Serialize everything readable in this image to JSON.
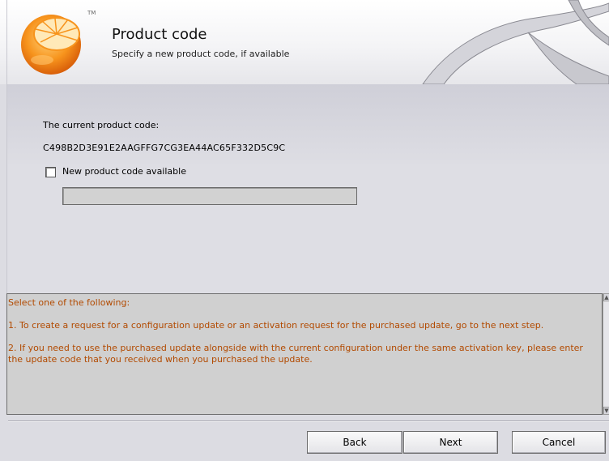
{
  "header": {
    "title": "Product code",
    "subtitle": "Specify a new product code, if available",
    "logo_icon": "orange-slice-logo-icon",
    "trademark": "TM"
  },
  "main": {
    "current_code_label": "The current product code:",
    "current_code_value": "C498B2D3E91E2AAGFFG7CG3EA44AC65F332D5C9C",
    "new_code_checkbox": {
      "label": "New product code available",
      "checked": false
    },
    "new_code_input": {
      "value": "",
      "placeholder": ""
    }
  },
  "info": {
    "line1": "Select one of the following:",
    "line2": "1. To create a request for a configuration update or an activation request for the purchased update, go to the next step.",
    "line3": "2. If you need to use the purchased update alongside with the current configuration under the same activation key, please enter the update code that you received when you purchased the update."
  },
  "footer": {
    "back_label": "Back",
    "next_label": "Next",
    "cancel_label": "Cancel"
  },
  "colors": {
    "info_text": "#b24a00",
    "logo_orange": "#f7941d",
    "background": "#dcdce2"
  }
}
